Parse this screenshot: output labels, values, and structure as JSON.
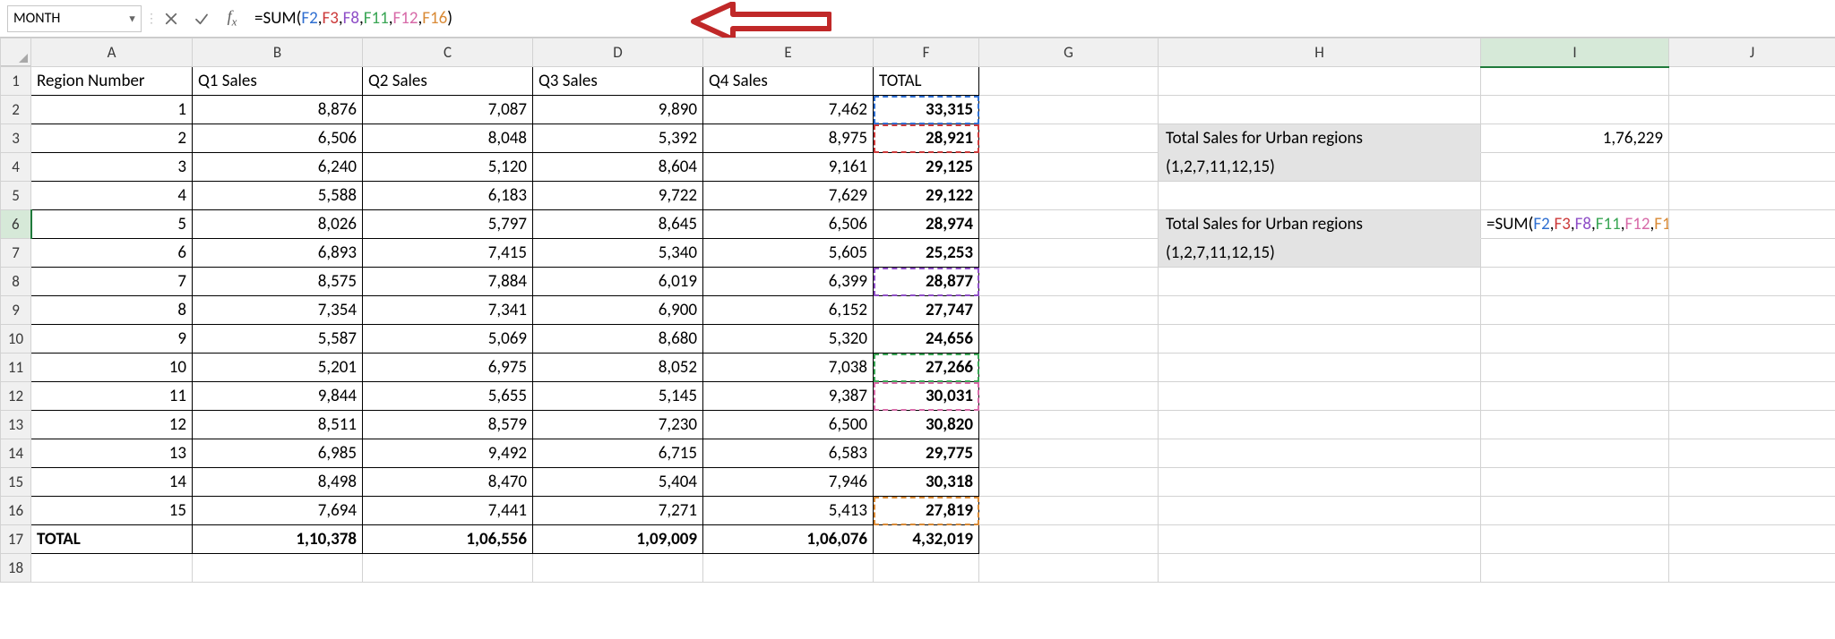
{
  "namebox": {
    "value": "MONTH"
  },
  "formula_bar": {
    "prefix": "=SUM(",
    "refs": [
      "F2",
      "F3",
      "F8",
      "F11",
      "F12",
      "F16"
    ],
    "suffix": ")"
  },
  "columns": [
    "A",
    "B",
    "C",
    "D",
    "E",
    "F",
    "G",
    "H",
    "I",
    "J"
  ],
  "headers": {
    "A": "Region Number",
    "B": "Q1 Sales",
    "C": "Q2 Sales",
    "D": "Q3 Sales",
    "E": "Q4 Sales",
    "F": "TOTAL"
  },
  "rows": [
    {
      "n": 1,
      "A": "1",
      "B": "8,876",
      "C": "7,087",
      "D": "9,890",
      "E": "7,462",
      "F": "33,315"
    },
    {
      "n": 2,
      "A": "2",
      "B": "6,506",
      "C": "8,048",
      "D": "5,392",
      "E": "8,975",
      "F": "28,921"
    },
    {
      "n": 3,
      "A": "3",
      "B": "6,240",
      "C": "5,120",
      "D": "8,604",
      "E": "9,161",
      "F": "29,125"
    },
    {
      "n": 4,
      "A": "4",
      "B": "5,588",
      "C": "6,183",
      "D": "9,722",
      "E": "7,629",
      "F": "29,122"
    },
    {
      "n": 5,
      "A": "5",
      "B": "8,026",
      "C": "5,797",
      "D": "8,645",
      "E": "6,506",
      "F": "28,974"
    },
    {
      "n": 6,
      "A": "6",
      "B": "6,893",
      "C": "7,415",
      "D": "5,340",
      "E": "5,605",
      "F": "25,253"
    },
    {
      "n": 7,
      "A": "7",
      "B": "8,575",
      "C": "7,884",
      "D": "6,019",
      "E": "6,399",
      "F": "28,877"
    },
    {
      "n": 8,
      "A": "8",
      "B": "7,354",
      "C": "7,341",
      "D": "6,900",
      "E": "6,152",
      "F": "27,747"
    },
    {
      "n": 9,
      "A": "9",
      "B": "5,587",
      "C": "5,069",
      "D": "8,680",
      "E": "5,320",
      "F": "24,656"
    },
    {
      "n": 10,
      "A": "10",
      "B": "5,201",
      "C": "6,975",
      "D": "8,052",
      "E": "7,038",
      "F": "27,266"
    },
    {
      "n": 11,
      "A": "11",
      "B": "9,844",
      "C": "5,655",
      "D": "5,145",
      "E": "9,387",
      "F": "30,031"
    },
    {
      "n": 12,
      "A": "12",
      "B": "8,511",
      "C": "8,579",
      "D": "7,230",
      "E": "6,500",
      "F": "30,820"
    },
    {
      "n": 13,
      "A": "13",
      "B": "6,985",
      "C": "9,492",
      "D": "6,715",
      "E": "6,583",
      "F": "29,775"
    },
    {
      "n": 14,
      "A": "14",
      "B": "8,498",
      "C": "8,470",
      "D": "5,404",
      "E": "7,946",
      "F": "30,318"
    },
    {
      "n": 15,
      "A": "15",
      "B": "7,694",
      "C": "7,441",
      "D": "7,271",
      "E": "5,413",
      "F": "27,819"
    }
  ],
  "totals_row": {
    "label": "TOTAL",
    "B": "1,10,378",
    "C": "1,06,556",
    "D": "1,09,009",
    "E": "1,06,076",
    "F": "4,32,019"
  },
  "side": {
    "label_line1": "Total Sales for Urban regions",
    "label_line2": "(1,2,7,11,12,15)",
    "result": "1,76,229"
  },
  "ref_colors": [
    "cf-blue",
    "cf-red",
    "cf-purple",
    "cf-green",
    "cf-pink",
    "cf-orange"
  ],
  "mark_map": {
    "F2": "mark-blue mark-dash",
    "F3": "mark-red mark-dash",
    "F8": "mark-purple mark-dash",
    "F11": "mark-green mark-dash",
    "F12": "mark-pink mark-dash",
    "F16": "mark-orange mark-dash"
  },
  "chart_data": {
    "type": "table",
    "title": "Quarterly Sales by Region with SUM formula for selected urban regions",
    "columns": [
      "Region Number",
      "Q1 Sales",
      "Q2 Sales",
      "Q3 Sales",
      "Q4 Sales",
      "TOTAL"
    ],
    "rows": [
      [
        1,
        8876,
        7087,
        9890,
        7462,
        33315
      ],
      [
        2,
        6506,
        8048,
        5392,
        8975,
        28921
      ],
      [
        3,
        6240,
        5120,
        8604,
        9161,
        29125
      ],
      [
        4,
        5588,
        6183,
        9722,
        7629,
        29122
      ],
      [
        5,
        8026,
        5797,
        8645,
        6506,
        28974
      ],
      [
        6,
        6893,
        7415,
        5340,
        5605,
        25253
      ],
      [
        7,
        8575,
        7884,
        6019,
        6399,
        28877
      ],
      [
        8,
        7354,
        7341,
        6900,
        6152,
        27747
      ],
      [
        9,
        5587,
        5069,
        8680,
        5320,
        24656
      ],
      [
        10,
        5201,
        6975,
        8052,
        7038,
        27266
      ],
      [
        11,
        9844,
        5655,
        5145,
        9387,
        30031
      ],
      [
        12,
        8511,
        8579,
        7230,
        6500,
        30820
      ],
      [
        13,
        6985,
        9492,
        6715,
        6583,
        29775
      ],
      [
        14,
        8498,
        8470,
        5404,
        7946,
        30318
      ],
      [
        15,
        7694,
        7441,
        7271,
        5413,
        27819
      ]
    ],
    "totals": {
      "Q1": 110378,
      "Q2": 106556,
      "Q3": 109009,
      "Q4": 106076,
      "TOTAL": 432019
    },
    "urban_regions": [
      1,
      2,
      7,
      11,
      12,
      15
    ],
    "urban_total": 176229,
    "formula": "=SUM(F2,F3,F8,F11,F12,F16)"
  }
}
